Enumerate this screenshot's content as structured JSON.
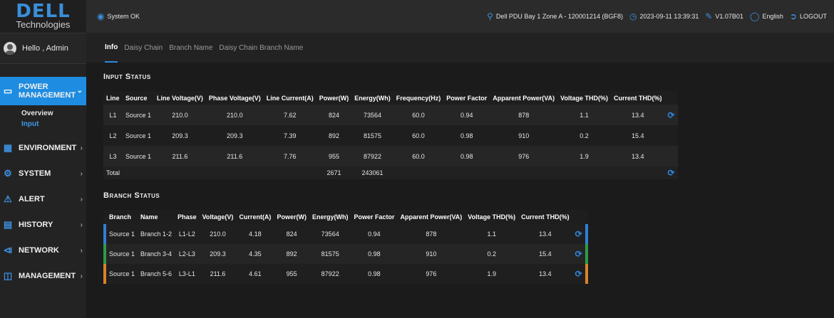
{
  "sidebar": {
    "logo_main": "DELL",
    "logo_sub": "Technologies",
    "greeting": "Hello , Admin",
    "items": [
      {
        "label": "POWER MANAGEMENT",
        "icon": "power-management-icon",
        "active": true
      },
      {
        "label": "ENVIRONMENT",
        "icon": "environment-icon"
      },
      {
        "label": "SYSTEM",
        "icon": "gear-icon"
      },
      {
        "label": "ALERT",
        "icon": "alert-icon"
      },
      {
        "label": "HISTORY",
        "icon": "calendar-icon"
      },
      {
        "label": "NETWORK",
        "icon": "network-icon"
      },
      {
        "label": "MANAGEMENT",
        "icon": "management-icon"
      }
    ],
    "subitems": [
      {
        "label": "Overview"
      },
      {
        "label": "Input",
        "selected": true
      }
    ]
  },
  "topbar": {
    "status": "System OK",
    "device": "Dell PDU Bay 1 Zone A - 120001214 (BGF8)",
    "datetime": "2023-09-11 13:39:31",
    "version": "V1.07B01",
    "language": "English",
    "logout": "LOGOUT"
  },
  "tabs": [
    "Info",
    "Daisy Chain",
    "Branch Name",
    "Daisy Chain Branch Name"
  ],
  "input_status": {
    "title": "Input Status",
    "headers": [
      "Line",
      "Source",
      "Line Voltage(V)",
      "Phase Voltage(V)",
      "Line Current(A)",
      "Power(W)",
      "Energy(Wh)",
      "Frequency(Hz)",
      "Power Factor",
      "Apparent Power(VA)",
      "Voltage THD(%)",
      "Current THD(%)"
    ],
    "rows": [
      [
        "L1",
        "Source 1",
        "210.0",
        "210.0",
        "7.62",
        "824",
        "73564",
        "60.0",
        "0.94",
        "878",
        "1.1",
        "13.4"
      ],
      [
        "L2",
        "Source 1",
        "209.3",
        "209.3",
        "7.39",
        "892",
        "81575",
        "60.0",
        "0.98",
        "910",
        "0.2",
        "15.4"
      ],
      [
        "L3",
        "Source 1",
        "211.6",
        "211.6",
        "7.76",
        "955",
        "87922",
        "60.0",
        "0.98",
        "976",
        "1.9",
        "13.4"
      ]
    ],
    "total": {
      "label": "Total",
      "power": "2671",
      "energy": "243061"
    }
  },
  "branch_status": {
    "title": "Branch Status",
    "headers": [
      "Branch",
      "Name",
      "Phase",
      "Voltage(V)",
      "Current(A)",
      "Power(W)",
      "Energy(Wh)",
      "Power Factor",
      "Apparent Power(VA)",
      "Voltage THD(%)",
      "Current THD(%)"
    ],
    "rows": [
      [
        "Source 1",
        "Branch 1-2",
        "L1-L2",
        "210.0",
        "4.18",
        "824",
        "73564",
        "0.94",
        "878",
        "1.1",
        "13.4"
      ],
      [
        "Source 1",
        "Branch 3-4",
        "L2-L3",
        "209.3",
        "4.35",
        "892",
        "81575",
        "0.98",
        "910",
        "0.2",
        "15.4"
      ],
      [
        "Source 1",
        "Branch 5-6",
        "L3-L1",
        "211.6",
        "4.61",
        "955",
        "87922",
        "0.98",
        "976",
        "1.9",
        "13.4"
      ]
    ],
    "row_colors": [
      "#2f7fd6",
      "#2e9a48",
      "#d9832a"
    ]
  },
  "colors": {
    "accent": "#1e8ce0",
    "refresh": "#2f86e0"
  }
}
